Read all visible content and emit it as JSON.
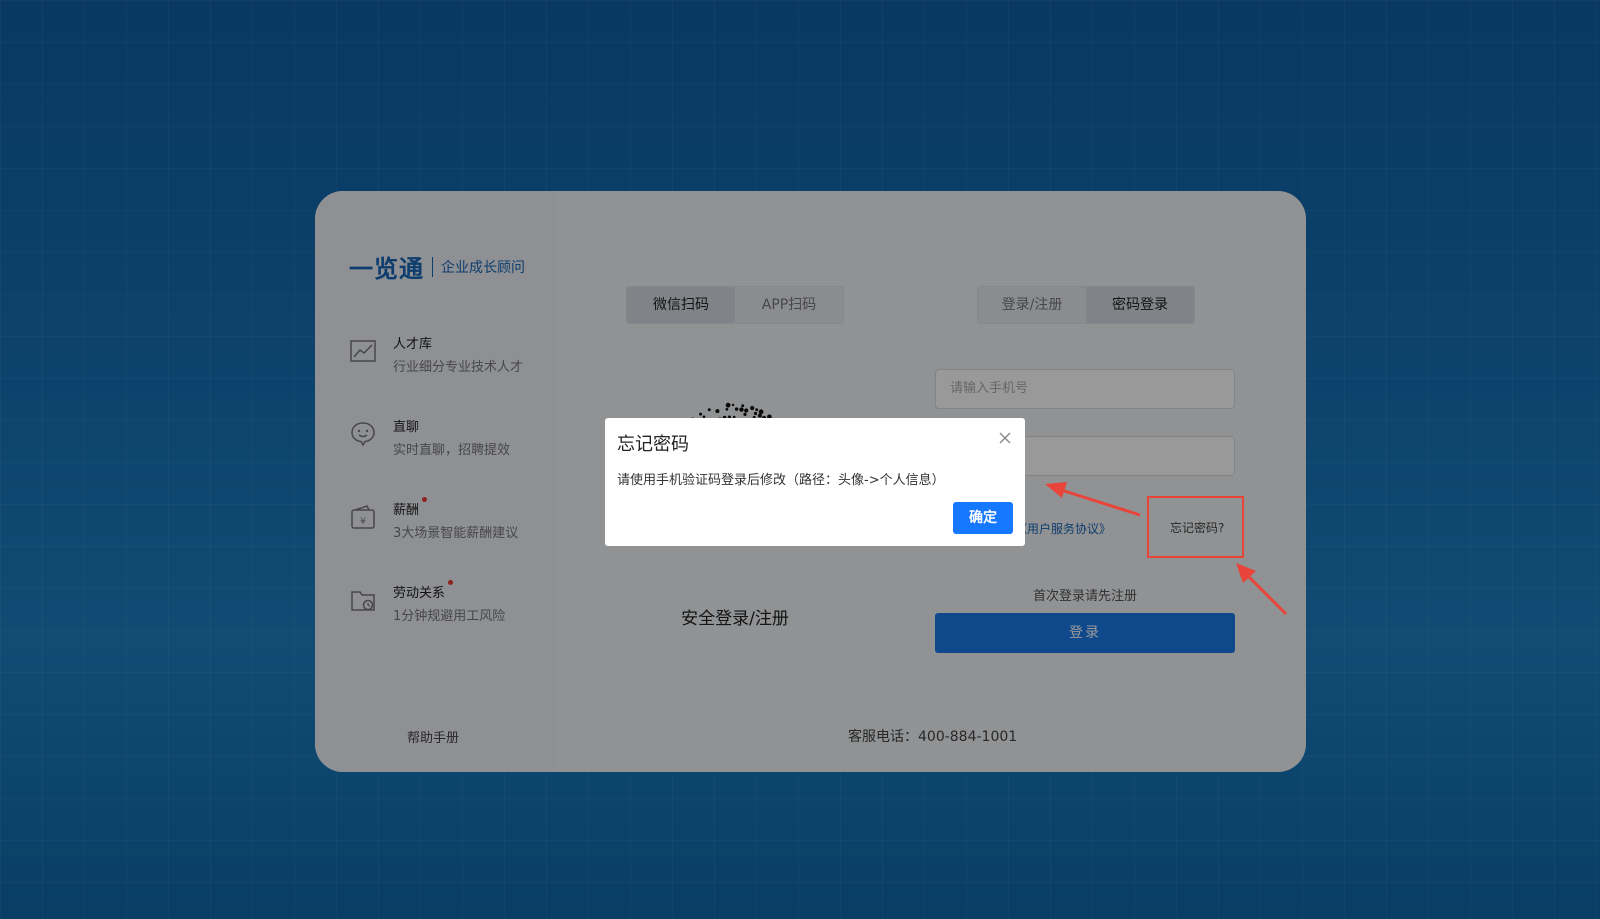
{
  "brand": {
    "name": "一览通",
    "tagline": "企业成长顾问"
  },
  "features": [
    {
      "title": "人才库",
      "desc": "行业细分专业技术人才",
      "icon": "chart-line-icon",
      "dot": false
    },
    {
      "title": "直聊",
      "desc": "实时直聊，招聘提效",
      "icon": "chat-bubble-icon",
      "dot": false
    },
    {
      "title": "薪酬",
      "desc": "3大场景智能薪酬建议",
      "icon": "wallet-yen-icon",
      "dot": true
    },
    {
      "title": "劳动关系",
      "desc": "1分钟规避用工风险",
      "icon": "folder-clock-icon",
      "dot": true
    }
  ],
  "help": "帮助手册",
  "scan_tabs": [
    "微信扫码",
    "APP扫码"
  ],
  "scan_active": "微信扫码",
  "qr_caption": "安全登录/注册",
  "login_tabs": [
    "登录/注册",
    "密码登录"
  ],
  "login_active": "密码登录",
  "phone_placeholder": "请输入手机号",
  "agreement_link": "《用户服务协议》",
  "forgot_link": "忘记密码?",
  "first_login_hint": "首次登录请先注册",
  "login_button": "登录",
  "service_phone": "客服电话：400-884-1001",
  "dialog": {
    "title": "忘记密码",
    "message": "请使用手机验证码登录后修改（路径：头像->个人信息）",
    "ok": "确定"
  },
  "colors": {
    "brand": "#1766b8",
    "primary_button": "#1677ff",
    "annotation": "#e8443a"
  }
}
